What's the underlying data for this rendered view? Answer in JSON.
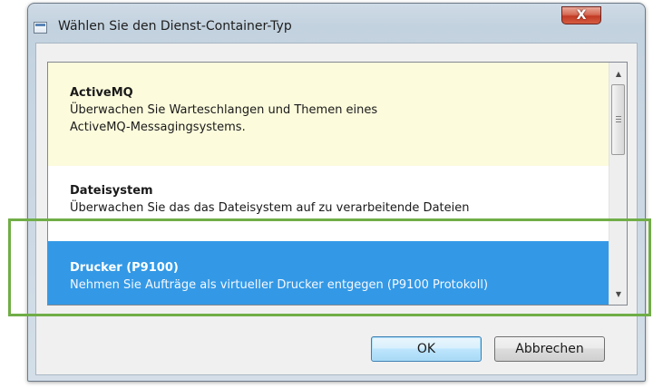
{
  "window": {
    "title": "Wählen Sie den Dienst-Container-Typ",
    "close_glyph": "X"
  },
  "list": {
    "items": [
      {
        "title": "ActiveMQ",
        "description_line1": "Überwachen Sie Warteschlangen und Themen eines",
        "description_line2": "ActiveMQ-Messagingsystems.",
        "state": "hover"
      },
      {
        "title": "Dateisystem",
        "description_line1": "Überwachen Sie das das Dateisystem auf zu verarbeitende Dateien",
        "state": "normal"
      },
      {
        "title": "Drucker (P9100)",
        "description_line1": "Nehmen Sie Aufträge als virtueller Drucker entgegen (P9100 Protokoll)",
        "state": "selected"
      }
    ]
  },
  "scrollbar": {
    "up_glyph": "▲",
    "down_glyph": "▼"
  },
  "buttons": {
    "ok_label": "OK",
    "cancel_label": "Abbrechen"
  },
  "colors": {
    "selection": "#3399e6",
    "hover": "#fcfbdc",
    "highlight_annotation": "#70ad47",
    "close_button": "#c23a23"
  }
}
